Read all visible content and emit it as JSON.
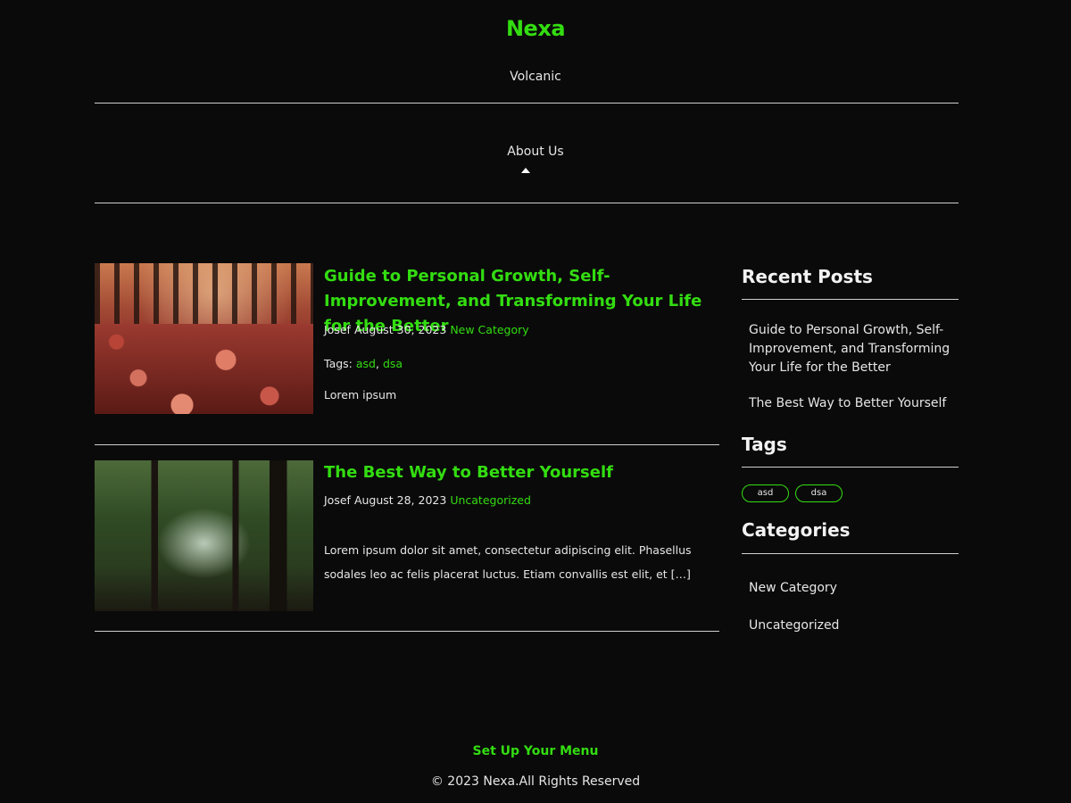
{
  "header": {
    "site_title": "Nexa",
    "tagline": "Volcanic"
  },
  "nav": {
    "items": [
      {
        "label": "About Us"
      }
    ]
  },
  "posts": [
    {
      "title": "Guide to Personal Growth, Self-Improvement, and Transforming Your Life for the Better",
      "author": "Josef",
      "date": "August 30, 2023",
      "category": "New Category",
      "tags_label": "Tags:",
      "tags": [
        "asd",
        "dsa"
      ],
      "tag_separator": ",",
      "excerpt": "Lorem ipsum"
    },
    {
      "title": "The Best Way to Better Yourself",
      "author": "Josef",
      "date": "August 28, 2023",
      "category": "Uncategorized",
      "excerpt": "Lorem ipsum dolor sit amet, consectetur adipiscing elit. Phasellus sodales leo ac felis placerat luctus. Etiam convallis est elit, et […]"
    }
  ],
  "sidebar": {
    "recent_posts": {
      "title": "Recent Posts",
      "items": [
        "Guide to Personal Growth, Self-Improvement, and Transforming Your Life for the Better",
        "The Best Way to Better Yourself"
      ]
    },
    "tags": {
      "title": "Tags",
      "items": [
        "asd",
        "dsa"
      ]
    },
    "categories": {
      "title": "Categories",
      "items": [
        "New Category",
        "Uncategorized"
      ]
    }
  },
  "footer": {
    "menu_link": "Set Up Your Menu",
    "copyright": "© 2023 Nexa.All Rights Reserved"
  },
  "colors": {
    "background": "#0a0a0a",
    "accent": "#33dd11",
    "text": "#e6e6e6",
    "divider": "#cfcfcf"
  }
}
